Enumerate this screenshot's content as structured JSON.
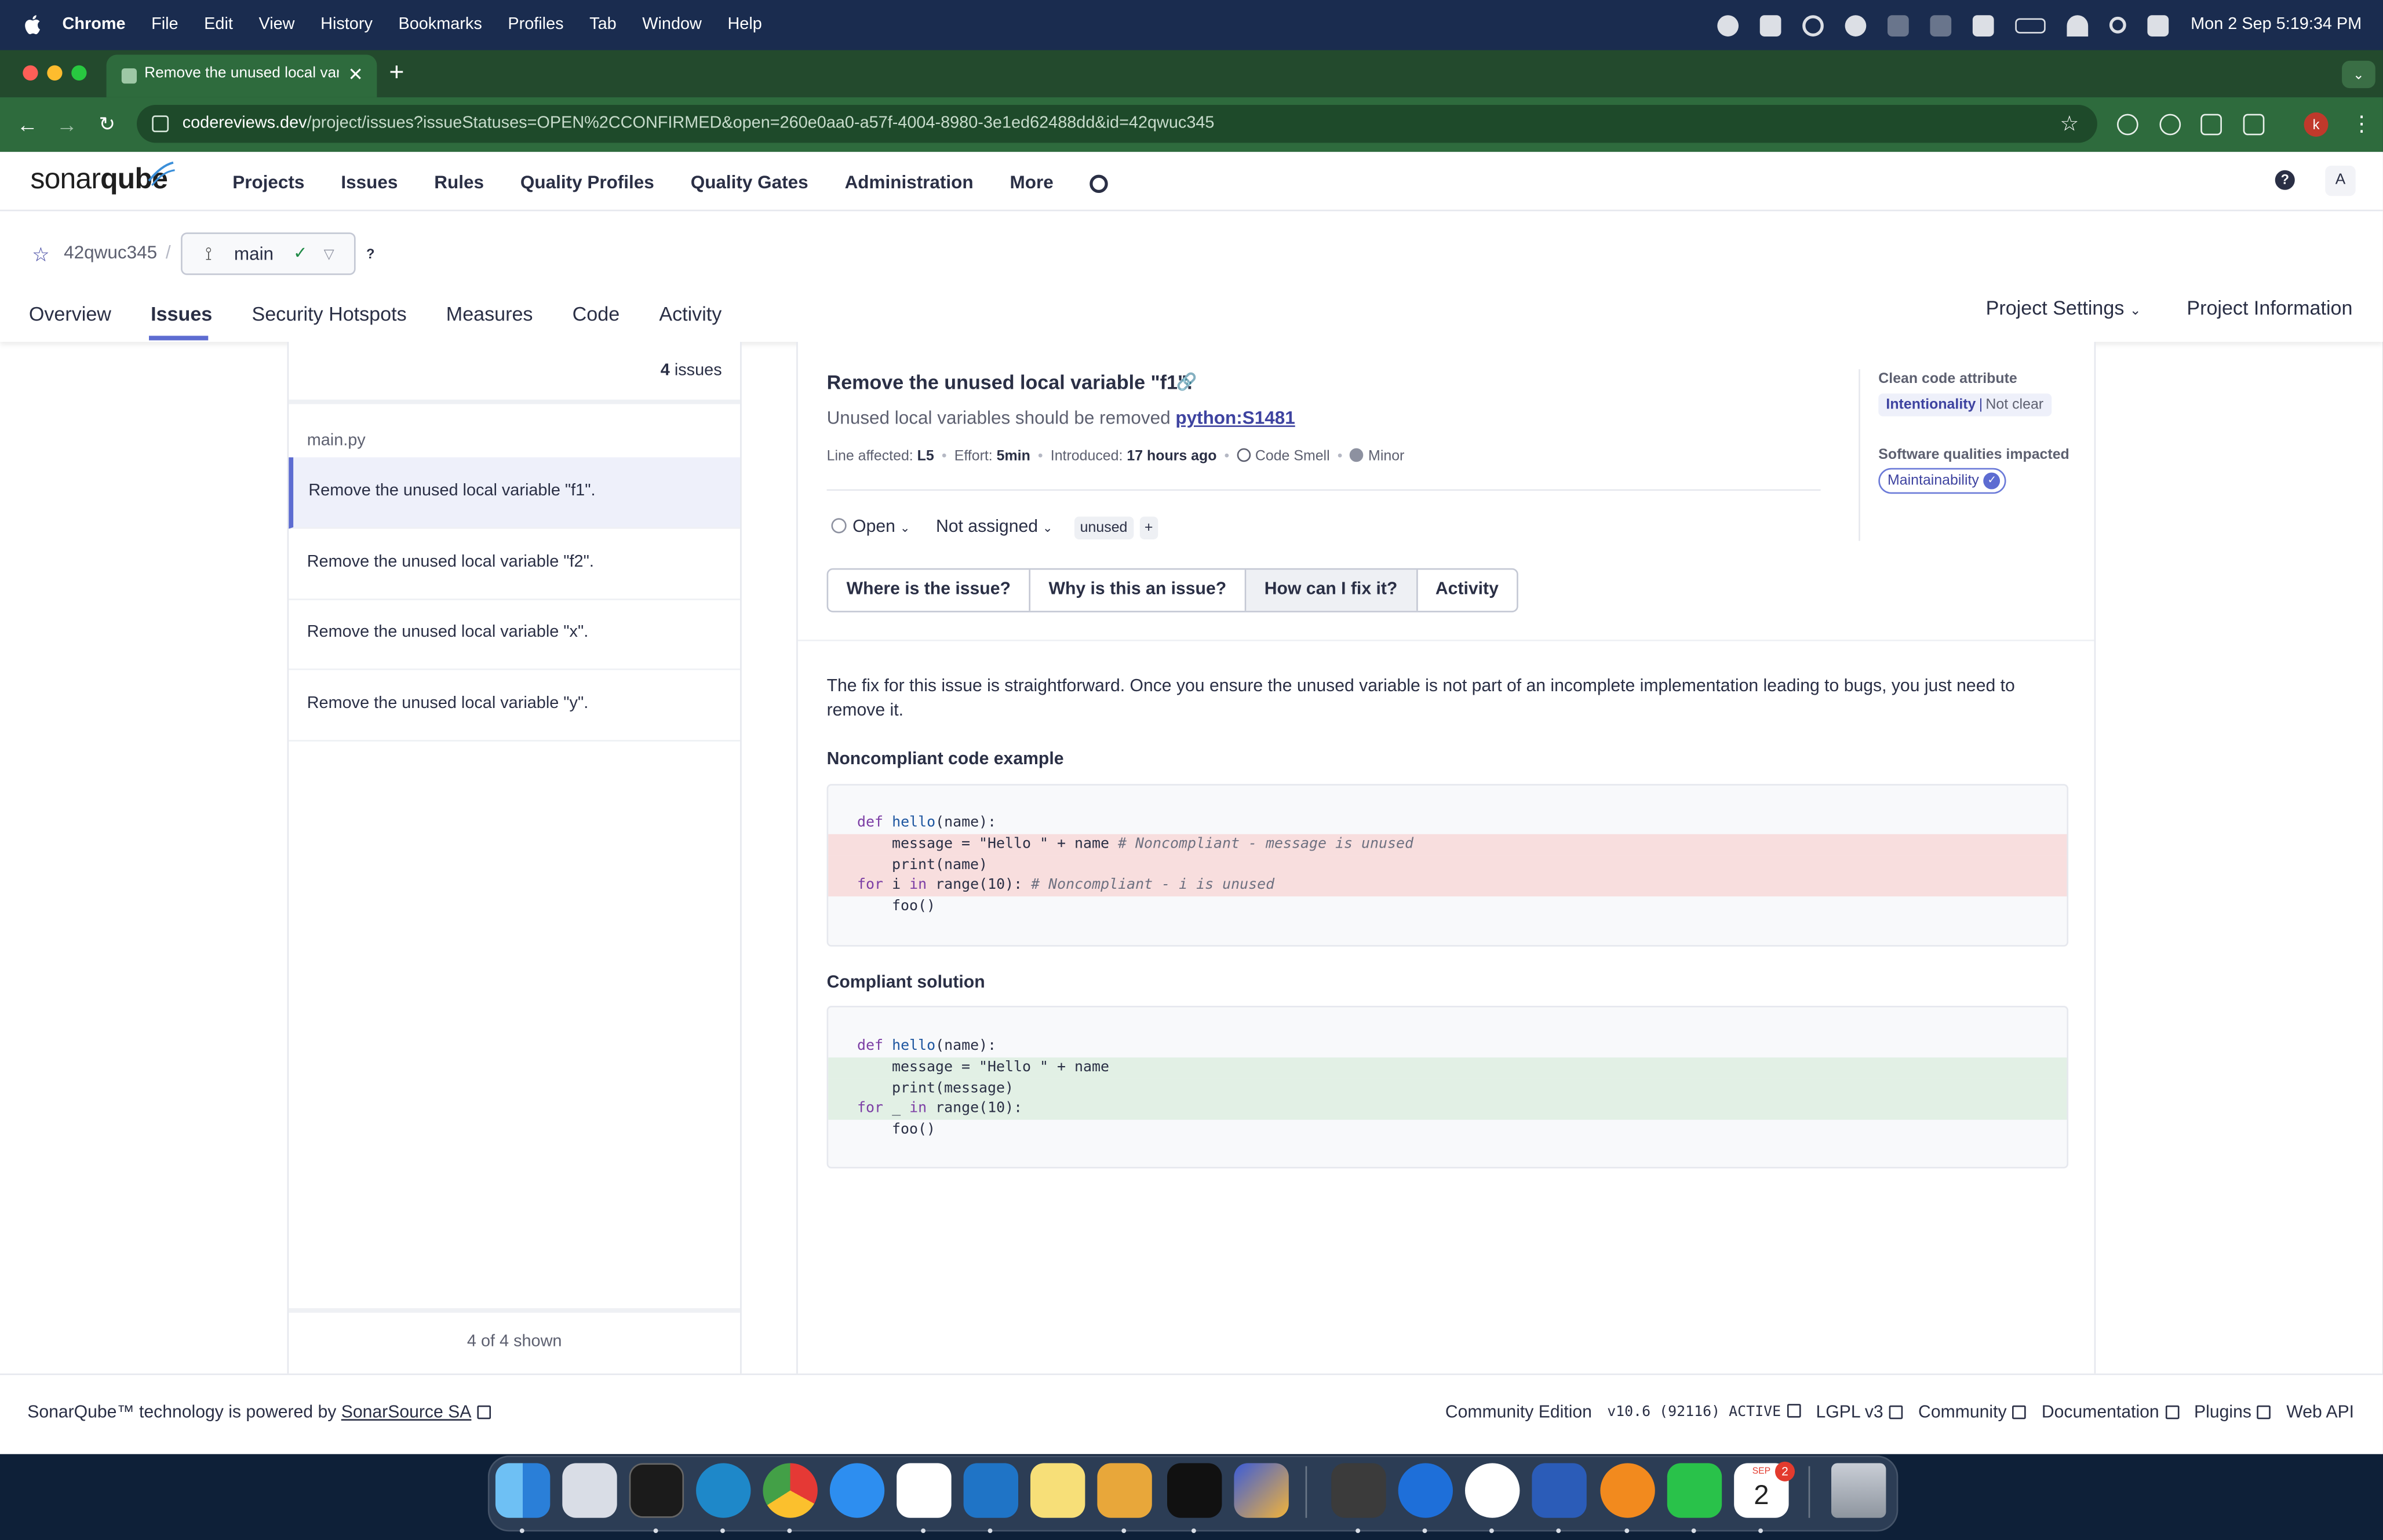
{
  "menubar": {
    "app": "Chrome",
    "items": [
      "File",
      "Edit",
      "View",
      "History",
      "Bookmarks",
      "Profiles",
      "Tab",
      "Window",
      "Help"
    ],
    "clock": "Mon 2 Sep  5:19:34 PM"
  },
  "browser": {
    "tab_title": "Remove the unused local vari",
    "url_host": "codereviews.dev",
    "url_path": "/project/issues?issueStatuses=OPEN%2CCONFIRMED&open=260e0aa0-a57f-4004-8980-3e1ed62488dd&id=42qwuc345",
    "profile_initial": "k"
  },
  "header": {
    "logo_a": "sonar",
    "logo_b": "qube",
    "nav": [
      "Projects",
      "Issues",
      "Rules",
      "Quality Profiles",
      "Quality Gates",
      "Administration",
      "More"
    ],
    "user_initial": "A",
    "help": "?"
  },
  "project": {
    "key": "42qwuc345",
    "branch": "main",
    "tabs": [
      "Overview",
      "Issues",
      "Security Hotspots",
      "Measures",
      "Code",
      "Activity"
    ],
    "settings": "Project Settings",
    "info": "Project Information"
  },
  "issue_list": {
    "count": "4",
    "count_label": "issues",
    "file": "main.py",
    "items": [
      "Remove the unused local variable \"f1\".",
      "Remove the unused local variable \"f2\".",
      "Remove the unused local variable \"x\".",
      "Remove the unused local variable \"y\"."
    ],
    "footer": "4 of 4 shown"
  },
  "issue": {
    "title": "Remove the unused local variable \"f1\".",
    "rule_text": "Unused local variables should be removed",
    "rule_key": "python:S1481",
    "meta": {
      "line_label": "Line affected:",
      "line_value": "L5",
      "effort_label": "Effort:",
      "effort_value": "5min",
      "introduced_label": "Introduced:",
      "introduced_value": "17 hours ago",
      "type": "Code Smell",
      "severity": "Minor"
    },
    "clean_code_label": "Clean code attribute",
    "clean_code_value": "Intentionality",
    "clean_code_detail": "Not clear",
    "qualities_label": "Software qualities impacted",
    "quality": "Maintainability",
    "status": "Open",
    "assignee": "Not assigned",
    "tag": "unused",
    "tag_add": "+",
    "tabs": [
      "Where is the issue?",
      "Why is this an issue?",
      "How can I fix it?",
      "Activity"
    ],
    "active_tab": 2,
    "fix_text": "The fix for this issue is straightforward. Once you ensure the unused variable is not part of an incomplete implementation leading to bugs, you just need to remove it.",
    "noncompliant_heading": "Noncompliant code example",
    "compliant_heading": "Compliant solution"
  },
  "footer": {
    "powered": "SonarQube™ technology is powered by",
    "sonarsource": "SonarSource SA",
    "edition": "Community Edition",
    "version": "v10.6 (92116) ACTIVE",
    "license": "LGPL v3",
    "community": "Community",
    "docs": "Documentation",
    "plugins": "Plugins",
    "api": "Web API"
  },
  "dock": {
    "calendar_month": "SEP",
    "calendar_day": "2",
    "calendar_badge": "2"
  },
  "colors": {
    "accent": "#5d6cd1",
    "chrome_green": "#2e6b3d",
    "noncompliant_bg": "#f8dede",
    "compliant_bg": "#e2f0e5"
  }
}
